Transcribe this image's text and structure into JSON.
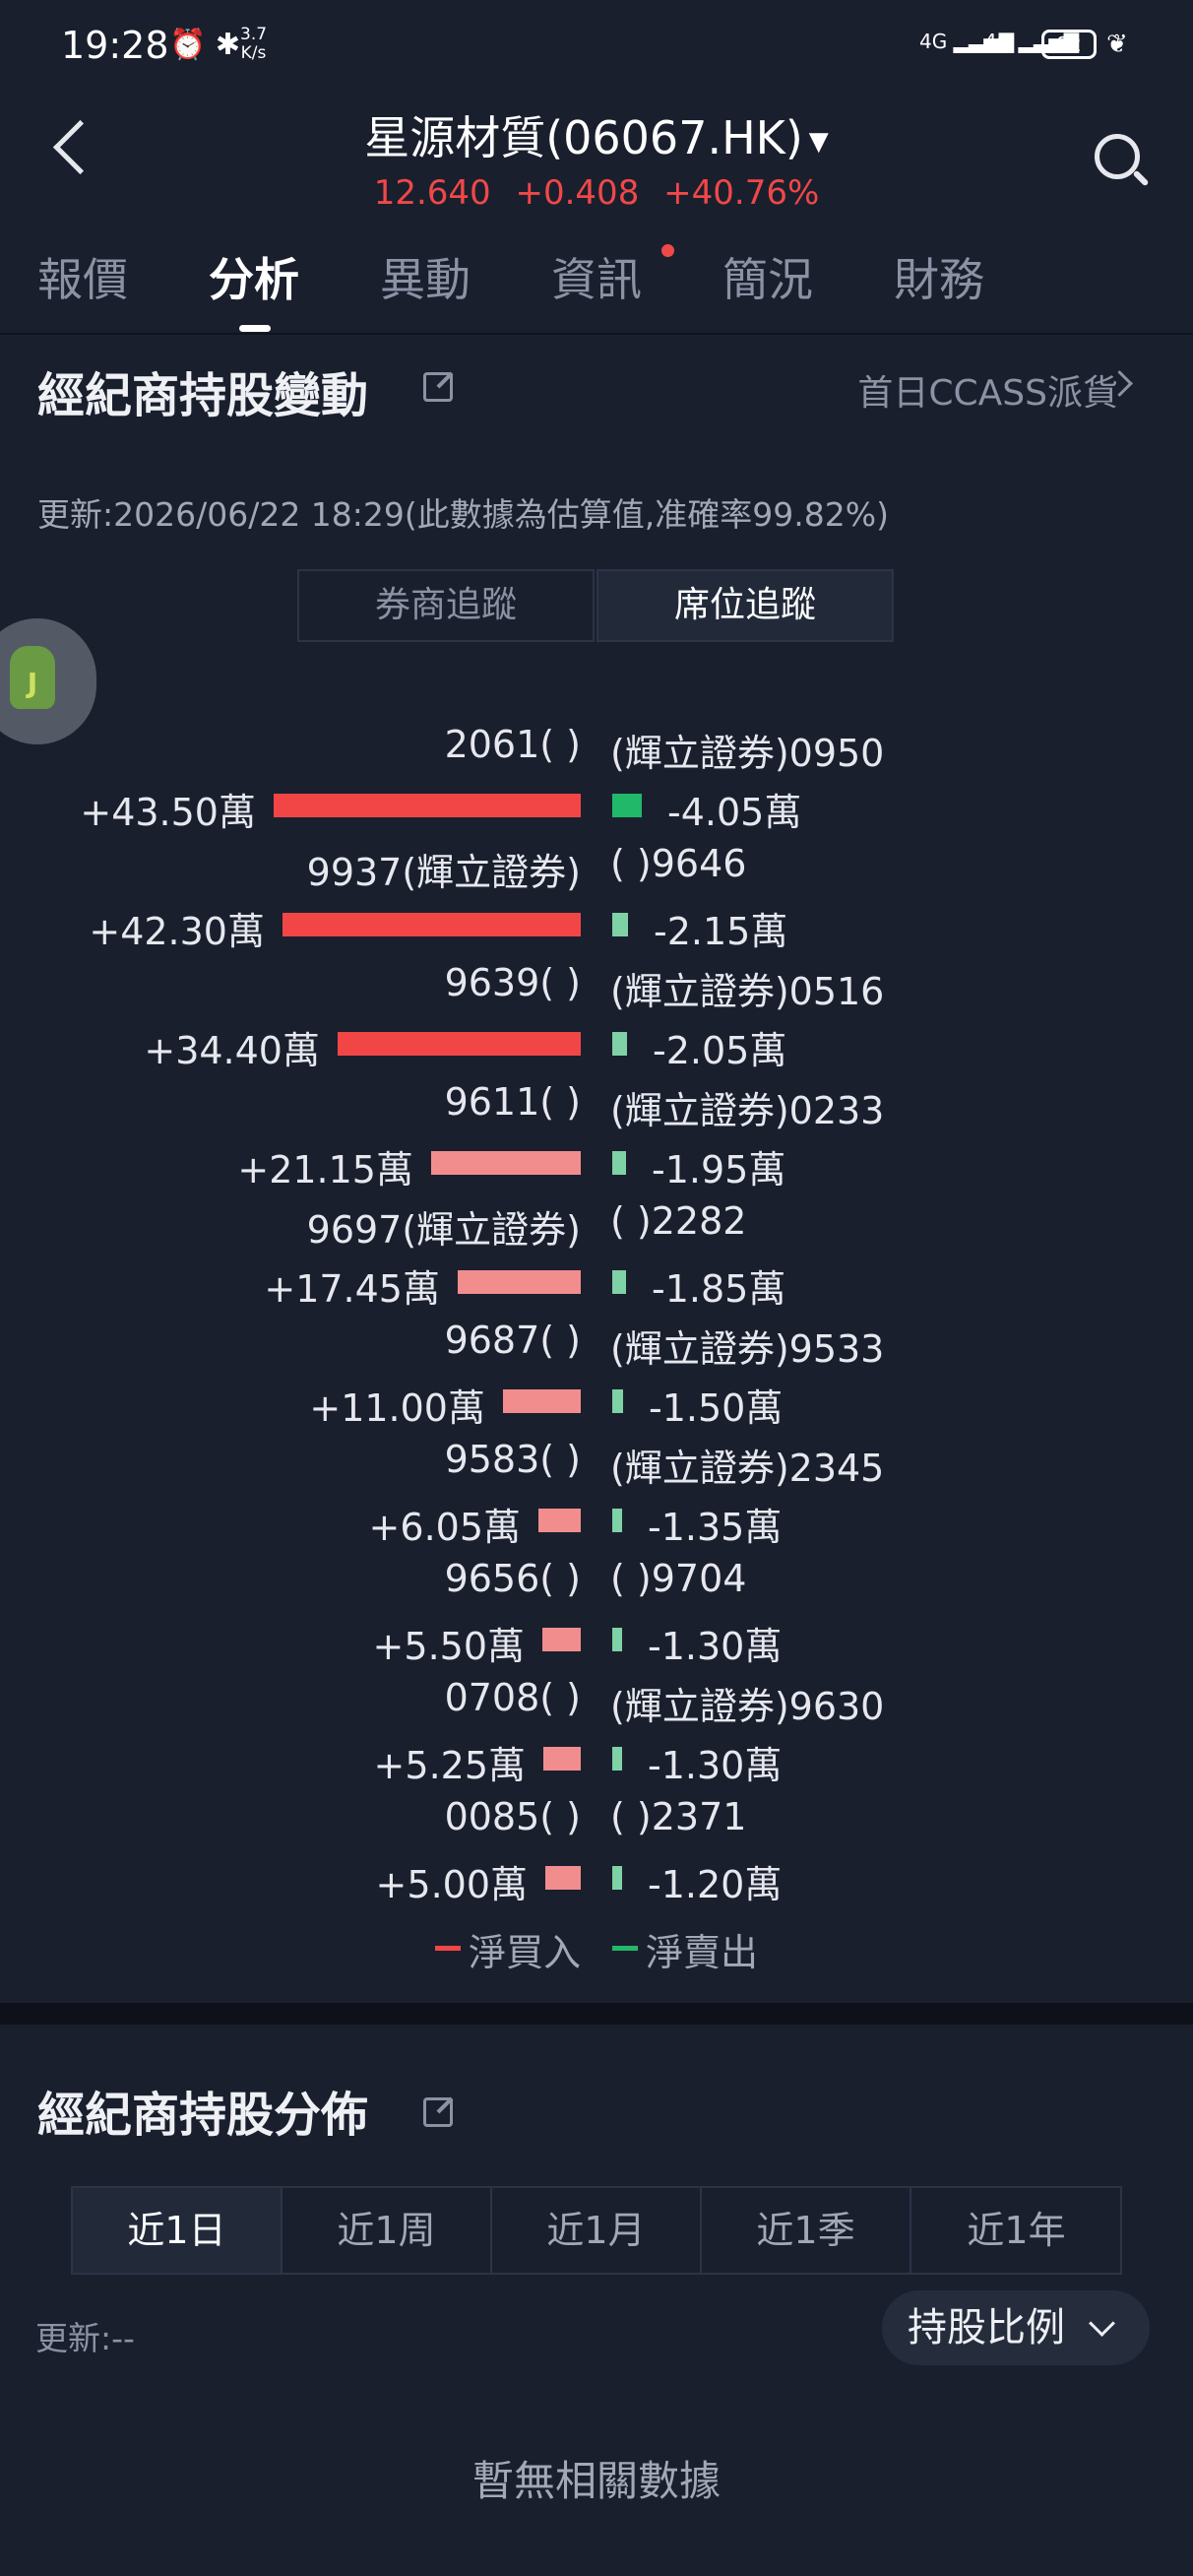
{
  "status_bar": {
    "time": "19:28",
    "icons": "⏰ ✱",
    "net_speed_top": "3.7",
    "net_speed_bottom": "K/s",
    "signal_1": "4G",
    "signal_2": "4G",
    "battery": "92"
  },
  "header": {
    "title": "星源材質(06067.HK)",
    "price": "12.640",
    "change": "+0.408",
    "change_pct": "+40.76%"
  },
  "tabs": [
    "報價",
    "分析",
    "異動",
    "資訊",
    "簡況",
    "財務"
  ],
  "active_tab": "分析",
  "broker_change": {
    "title": "經紀商持股變動",
    "ccass_link": "首日CCASS派貨",
    "update_text": "更新:2026/06/22 18:29(此數據為估算值,准確率99.82%)",
    "segments": [
      "券商追蹤",
      "席位追蹤"
    ],
    "active_segment": "席位追蹤",
    "rows": [
      {
        "buy_label": "2061( )",
        "sell_label": "(輝立證券)0950",
        "buy_value": "+43.50萬",
        "sell_value": "-4.05萬",
        "buy": 43.5,
        "sell": 4.05
      },
      {
        "buy_label": "9937(輝立證券)",
        "sell_label": "( )9646",
        "buy_value": "+42.30萬",
        "sell_value": "-2.15萬",
        "buy": 42.3,
        "sell": 2.15
      },
      {
        "buy_label": "9639( )",
        "sell_label": "(輝立證券)0516",
        "buy_value": "+34.40萬",
        "sell_value": "-2.05萬",
        "buy": 34.4,
        "sell": 2.05
      },
      {
        "buy_label": "9611( )",
        "sell_label": "(輝立證券)0233",
        "buy_value": "+21.15萬",
        "sell_value": "-1.95萬",
        "buy": 21.15,
        "sell": 1.95
      },
      {
        "buy_label": "9697(輝立證券)",
        "sell_label": "( )2282",
        "buy_value": "+17.45萬",
        "sell_value": "-1.85萬",
        "buy": 17.45,
        "sell": 1.85
      },
      {
        "buy_label": "9687( )",
        "sell_label": "(輝立證券)9533",
        "buy_value": "+11.00萬",
        "sell_value": "-1.50萬",
        "buy": 11.0,
        "sell": 1.5
      },
      {
        "buy_label": "9583( )",
        "sell_label": "(輝立證券)2345",
        "buy_value": "+6.05萬",
        "sell_value": "-1.35萬",
        "buy": 6.05,
        "sell": 1.35
      },
      {
        "buy_label": "9656( )",
        "sell_label": "( )9704",
        "buy_value": "+5.50萬",
        "sell_value": "-1.30萬",
        "buy": 5.5,
        "sell": 1.3
      },
      {
        "buy_label": "0708( )",
        "sell_label": "(輝立證券)9630",
        "buy_value": "+5.25萬",
        "sell_value": "-1.30萬",
        "buy": 5.25,
        "sell": 1.3
      },
      {
        "buy_label": "0085( )",
        "sell_label": "( )2371",
        "buy_value": "+5.00萬",
        "sell_value": "-1.20萬",
        "buy": 5.0,
        "sell": 1.2
      }
    ],
    "legend_buy": "淨買入",
    "legend_sell": "淨賣出",
    "colors": {
      "buy_strong": "#f24646",
      "buy_light": "#f28d8e",
      "sell_strong": "#22b869",
      "sell_light": "#7fd2a6"
    }
  },
  "broker_distribution": {
    "title": "經紀商持股分佈",
    "periods": [
      "近1日",
      "近1周",
      "近1月",
      "近1季",
      "近1年"
    ],
    "active_period": "近1日",
    "update_text": "更新:--",
    "metric_select": "持股比例",
    "empty_text": "暫無相關數據"
  }
}
